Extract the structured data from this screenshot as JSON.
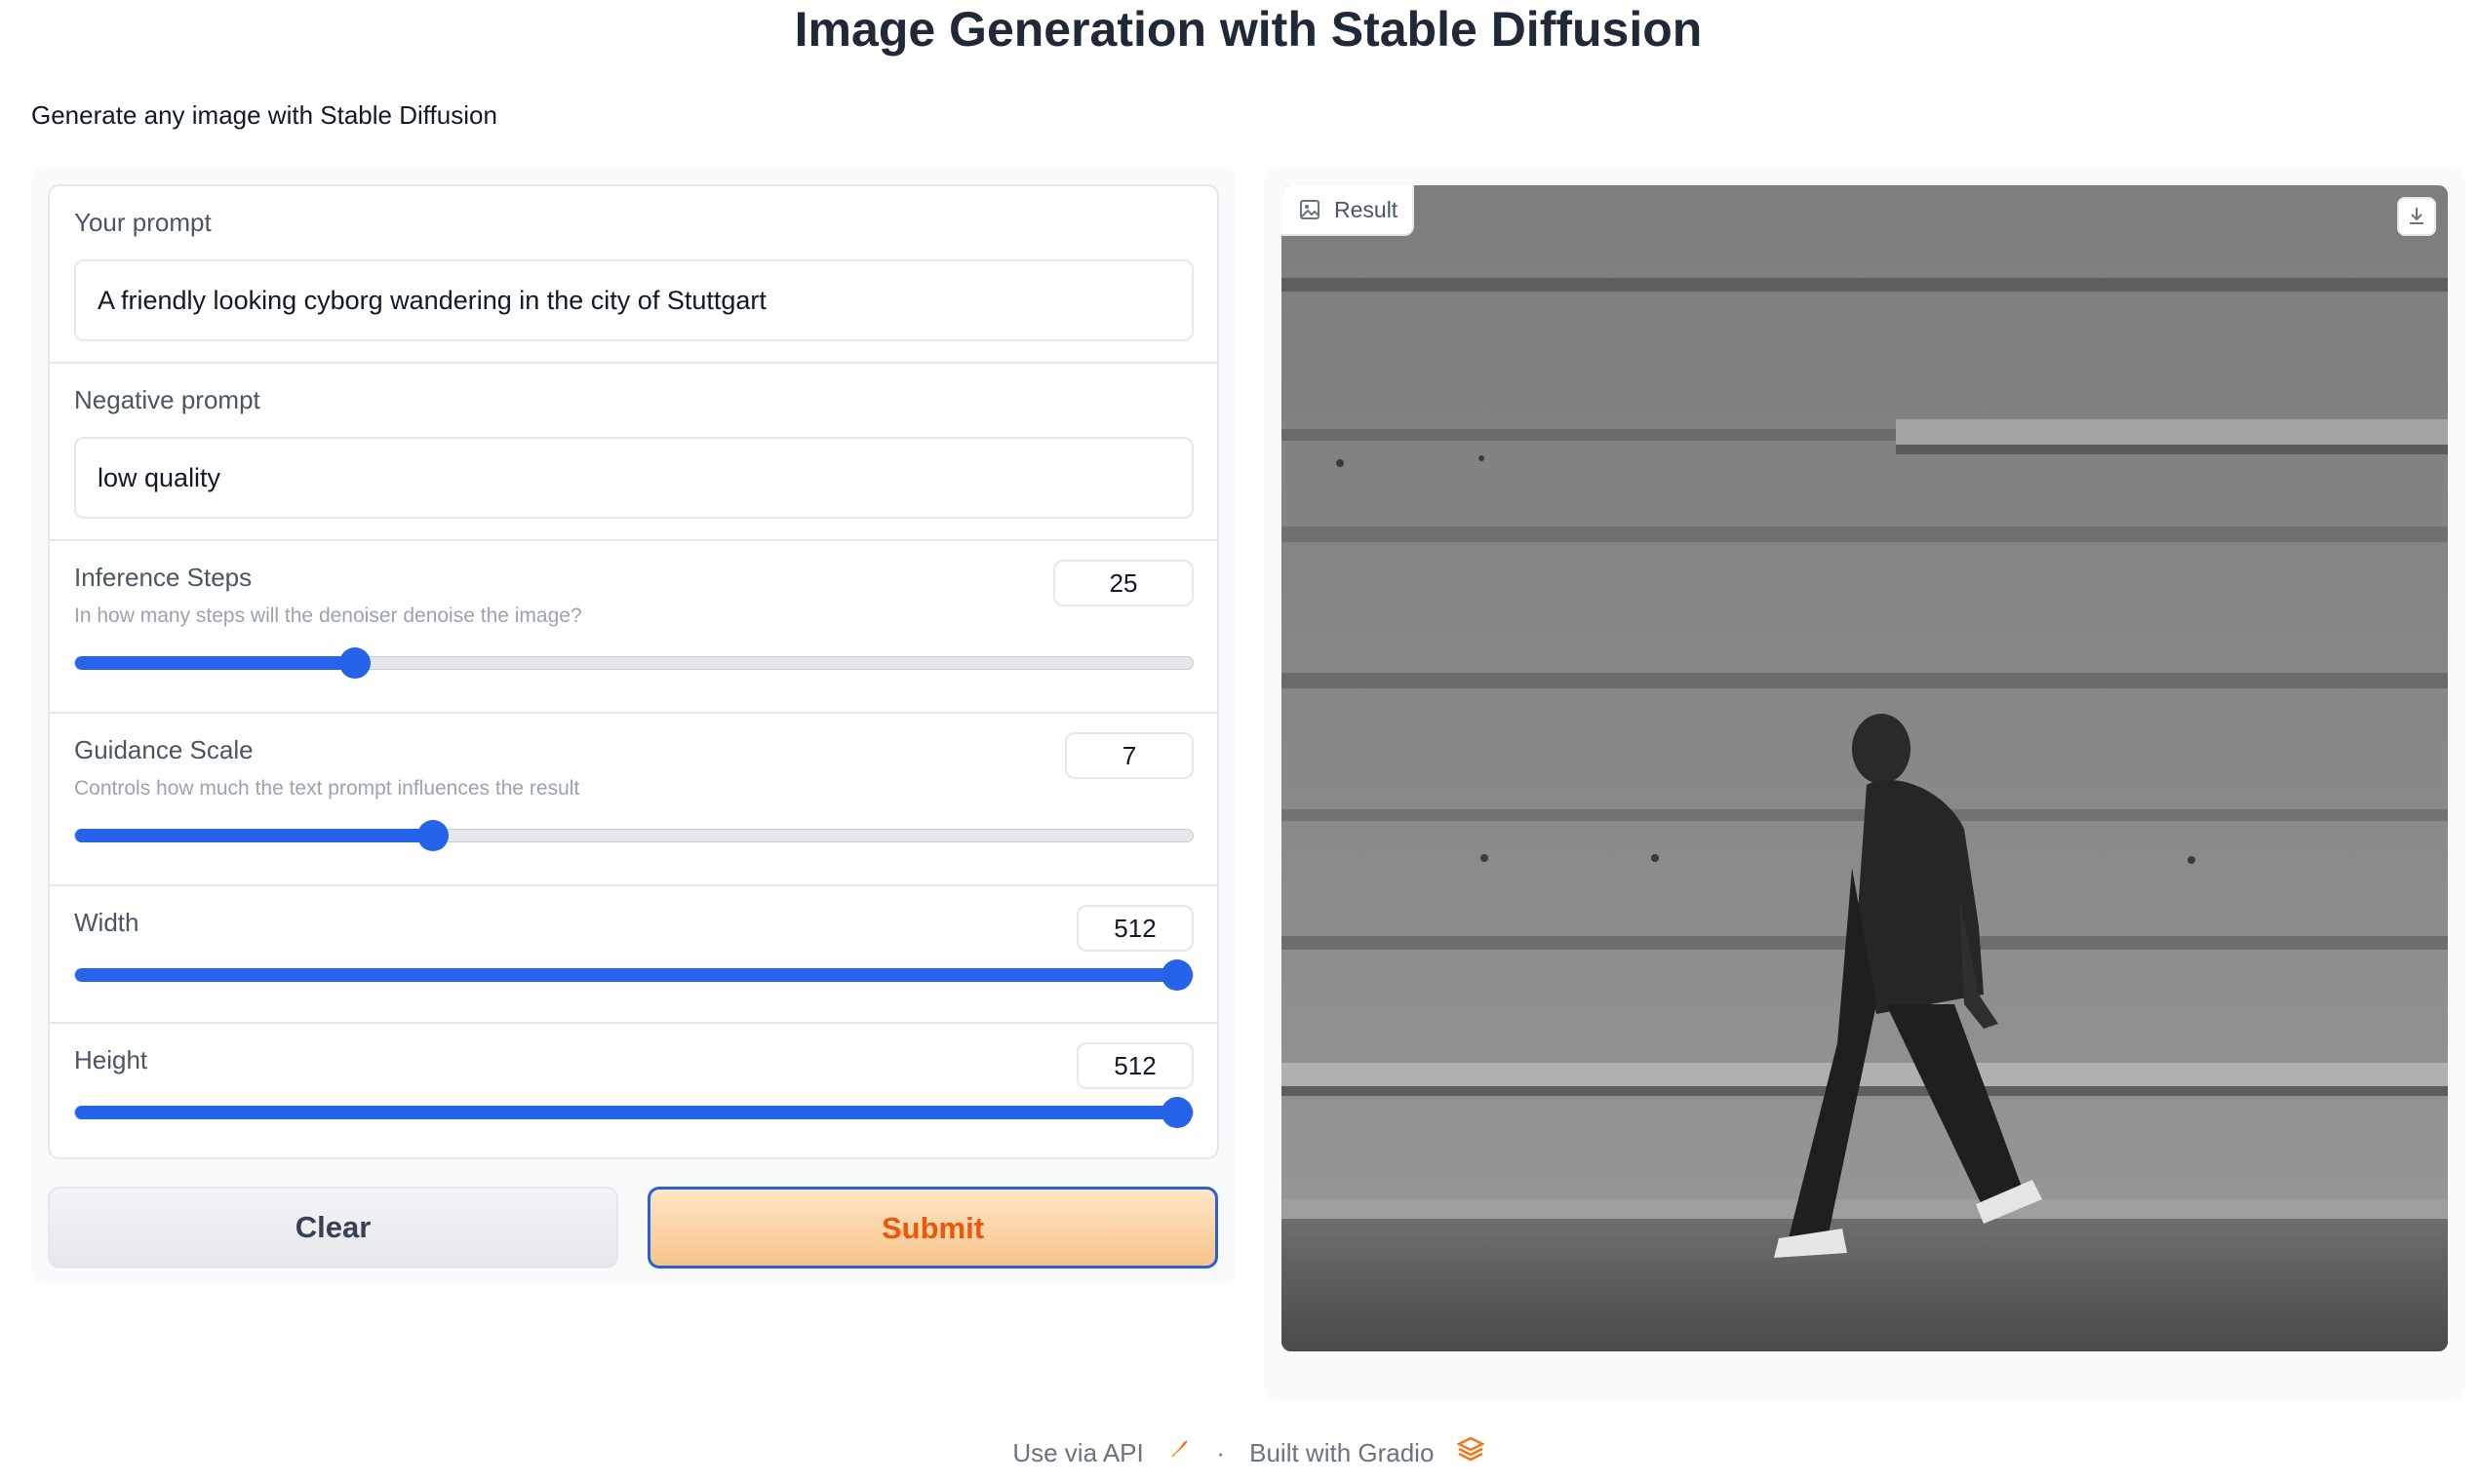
{
  "header": {
    "title": "Image Generation with Stable Diffusion",
    "description": "Generate any image with Stable Diffusion"
  },
  "form": {
    "prompt": {
      "label": "Your prompt",
      "value": "A friendly looking cyborg wandering in the city of Stuttgart"
    },
    "negative_prompt": {
      "label": "Negative prompt",
      "value": "low quality"
    },
    "inference_steps": {
      "label": "Inference Steps",
      "info": "In how many steps will the denoiser denoise the image?",
      "value": "25",
      "fraction": 0.25
    },
    "guidance_scale": {
      "label": "Guidance Scale",
      "info": "Controls how much the text prompt influences the result",
      "value": "7",
      "fraction": 0.32
    },
    "width": {
      "label": "Width",
      "value": "512",
      "fraction": 1.0
    },
    "height": {
      "label": "Height",
      "value": "512",
      "fraction": 1.0
    }
  },
  "buttons": {
    "clear": "Clear",
    "submit": "Submit"
  },
  "result": {
    "label": "Result",
    "image_icon": "image-icon",
    "download_icon": "download-icon"
  },
  "footer": {
    "api": "Use via API",
    "separator": "·",
    "built": "Built with Gradio"
  },
  "colors": {
    "accent": "#2563eb",
    "submit_text": "#ea580c",
    "submit_border": "#2c5fd6"
  }
}
